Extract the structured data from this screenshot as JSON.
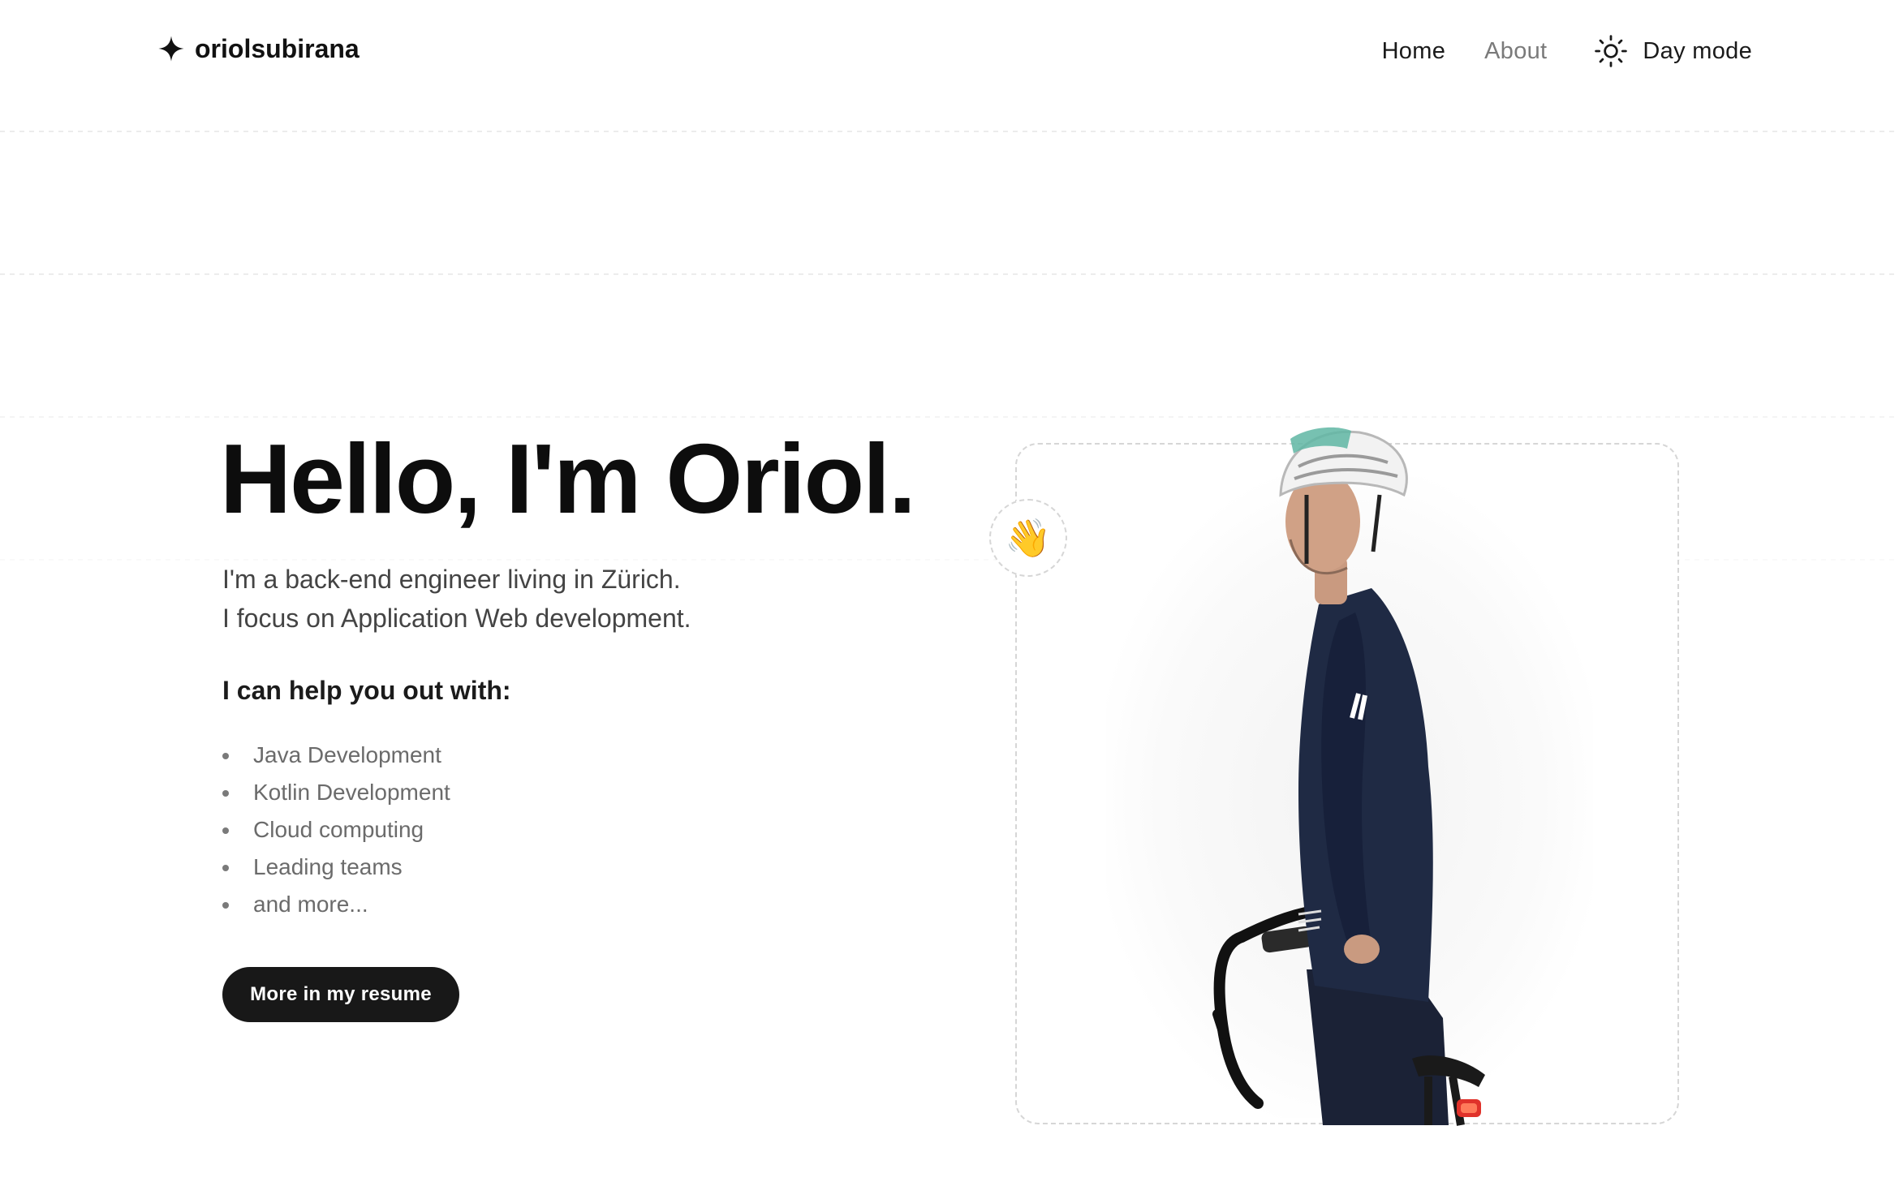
{
  "header": {
    "logo_text": "oriolsubirana",
    "logo_icon": "sparkle-icon",
    "nav": {
      "home": "Home",
      "about": "About",
      "mode_label": "Day mode",
      "mode_icon": "sun-icon"
    }
  },
  "hero": {
    "title": "Hello, I'm Oriol.",
    "intro_line1": "I'm a back-end engineer living in Zürich.",
    "intro_line2": "I focus on Application Web development.",
    "help_heading": "I can help you out with:",
    "skills": [
      "Java Development",
      "Kotlin Development",
      "Cloud computing",
      "Leading teams",
      "and more..."
    ],
    "cta_label": "More in my resume",
    "wave_emoji": "👋"
  },
  "colors": {
    "text_primary": "#111111",
    "text_muted": "#6b6b6b",
    "button_bg": "#181818",
    "jersey": "#1f2a44"
  }
}
